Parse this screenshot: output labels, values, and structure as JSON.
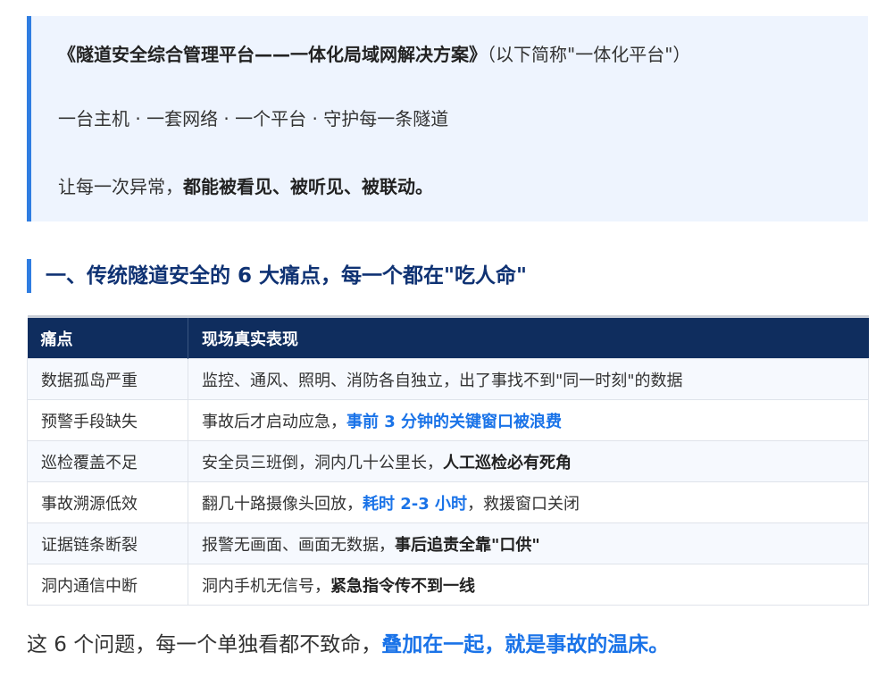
{
  "intro": {
    "line1_bold": "《隧道安全综合管理平台——一体化局域网解决方案》",
    "line1_rest": "（以下简称\"一体化平台\"）",
    "line2": "一台主机 · 一套网络 · 一个平台 · 守护每一条隧道",
    "line3_plain": "让每一次异常，",
    "line3_bold": "都能被看见、被听见、被联动。"
  },
  "section": {
    "heading": "一、传统隧道安全的 6 大痛点，每一个都在\"吃人命\""
  },
  "table": {
    "headers": [
      "痛点",
      "现场真实表现"
    ],
    "rows": [
      {
        "pain": "数据孤岛严重",
        "desc_plain": "监控、通风、照明、消防各自独立，出了事找不到\"同一时刻\"的数据",
        "desc_hl": "",
        "desc_after": "",
        "hl_style": "none"
      },
      {
        "pain": "预警手段缺失",
        "desc_plain": "事故后才启动应急，",
        "desc_hl": "事前 3 分钟的关键窗口被浪费",
        "desc_after": "",
        "hl_style": "blue"
      },
      {
        "pain": "巡检覆盖不足",
        "desc_plain": "安全员三班倒，洞内几十公里长，",
        "desc_hl": "人工巡检必有死角",
        "desc_after": "",
        "hl_style": "bold"
      },
      {
        "pain": "事故溯源低效",
        "desc_plain": "翻几十路摄像头回放，",
        "desc_hl": "耗时 2-3 小时",
        "desc_after": "，救援窗口关闭",
        "hl_style": "blue"
      },
      {
        "pain": "证据链条断裂",
        "desc_plain": "报警无画面、画面无数据，",
        "desc_hl": "事后追责全靠\"口供\"",
        "desc_after": "",
        "hl_style": "bold"
      },
      {
        "pain": "洞内通信中断",
        "desc_plain": "洞内手机无信号，",
        "desc_hl": "紧急指令传不到一线",
        "desc_after": "",
        "hl_style": "bold"
      }
    ]
  },
  "conclusion": {
    "plain": "这 6 个问题，每一个单独看都不致命，",
    "highlight": "叠加在一起，就是事故的温床。"
  },
  "colors": {
    "accent_blue": "#2f7de1",
    "header_navy": "#0f2d5e",
    "highlight_blue": "#1a73e8",
    "quote_bg": "#eef4fe"
  }
}
